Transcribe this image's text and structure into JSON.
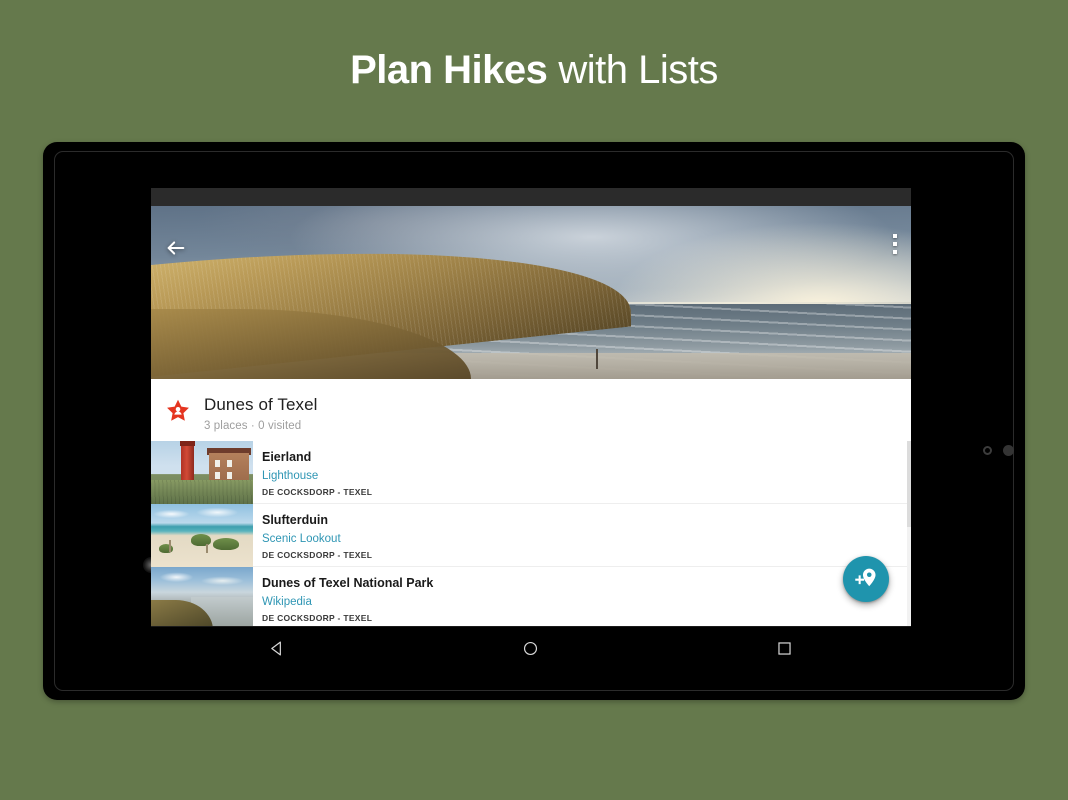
{
  "headline": {
    "bold_part": "Plan Hikes",
    "light_part": "with Lists"
  },
  "colors": {
    "background_green": "#65794c",
    "accent_teal": "#1f94ad",
    "link_blue": "#2f96b4",
    "star_red": "#e53520",
    "card_white": "#ffffff",
    "status_bar": "#2b2b2b"
  },
  "app": {
    "status_bar": {},
    "hero": {
      "back_icon": "arrow-left-icon",
      "overflow_icon": "more-vertical-icon",
      "alt": "coastal dune landscape with sea"
    },
    "list_header": {
      "star_icon": "starred-place-icon",
      "title": "Dunes of Texel",
      "subtitle": "3 places · 0 visited"
    },
    "places": [
      {
        "thumb": "lighthouse-thumbnail",
        "name": "Eierland",
        "category": "Lighthouse",
        "location": "DE COCKSDORP - TEXEL"
      },
      {
        "thumb": "beach-dunes-thumbnail",
        "name": "Slufterduin",
        "category": "Scenic Lookout",
        "location": "DE COCKSDORP - TEXEL"
      },
      {
        "thumb": "coast-overview-thumbnail",
        "name": "Dunes of Texel National Park",
        "category": "Wikipedia",
        "location": "DE COCKSDORP - TEXEL"
      }
    ],
    "fab": {
      "icon": "add-place-pin-icon",
      "label": "Add place"
    },
    "navigation_bar": {
      "back": "back-triangle-icon",
      "home": "home-circle-icon",
      "recents": "recents-square-icon"
    }
  },
  "device": {
    "camera_icon": "front-camera-dot",
    "sensor_icon_1": "sensor-dot",
    "sensor_icon_2": "sensor-dot"
  }
}
